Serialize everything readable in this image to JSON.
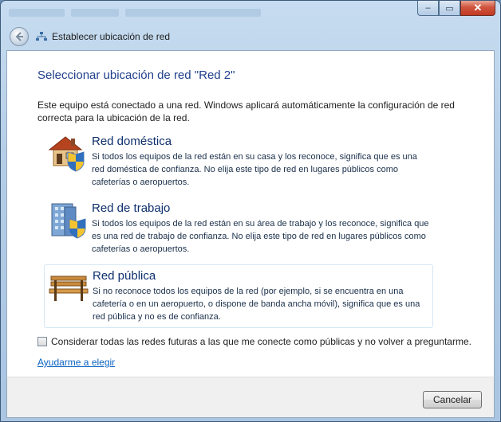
{
  "window": {
    "nav_title": "Establecer ubicación de red",
    "controls": {
      "minimize": "–",
      "maximize": "▭",
      "close": "✕"
    }
  },
  "main": {
    "heading": "Seleccionar ubicación de red \"Red  2\"",
    "intro": "Este equipo está conectado a una red. Windows aplicará automáticamente la configuración de red correcta para la ubicación de la red.",
    "options": [
      {
        "icon": "house-shield-icon",
        "title": "Red doméstica",
        "desc": "Si todos los equipos de la red están en su casa y los reconoce, significa que es una red doméstica de confianza. No elija este tipo de red en lugares públicos como cafeterías o aeropuertos."
      },
      {
        "icon": "office-building-shield-icon",
        "title": "Red de trabajo",
        "desc": "Si todos los equipos de la red están en su área de trabajo y los reconoce, significa que es una red de trabajo de confianza. No elija este tipo de red en lugares públicos como cafeterías o aeropuertos."
      },
      {
        "icon": "park-bench-icon",
        "title": "Red pública",
        "desc": "Si no reconoce todos los equipos de la red (por ejemplo, si se encuentra en una cafetería o en un aeropuerto, o dispone de banda ancha móvil), significa que es una red pública y no es de confianza."
      }
    ],
    "checkbox_label": "Considerar todas las redes futuras a las que me conecte como públicas y no volver a preguntarme.",
    "checkbox_checked": false,
    "help_link": "Ayudarme a elegir"
  },
  "footer": {
    "cancel_label": "Cancelar"
  }
}
